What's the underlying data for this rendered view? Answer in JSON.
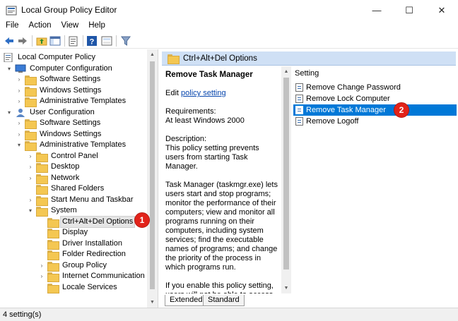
{
  "window": {
    "title": "Local Group Policy Editor",
    "minimize": "—",
    "maximize": "☐",
    "close": "✕"
  },
  "menu": [
    "File",
    "Action",
    "View",
    "Help"
  ],
  "tree": {
    "items": [
      {
        "label": "Local Computer Policy",
        "level": 0,
        "chevron": "",
        "icon": "policy-icon"
      },
      {
        "label": "Computer Configuration",
        "level": 1,
        "chevron": "▾",
        "icon": "computer-icon"
      },
      {
        "label": "Software Settings",
        "level": 2,
        "chevron": "›",
        "icon": "folder-icon"
      },
      {
        "label": "Windows Settings",
        "level": 2,
        "chevron": "›",
        "icon": "folder-icon"
      },
      {
        "label": "Administrative Templates",
        "level": 2,
        "chevron": "›",
        "icon": "folder-icon"
      },
      {
        "label": "User Configuration",
        "level": 1,
        "chevron": "▾",
        "icon": "user-icon"
      },
      {
        "label": "Software Settings",
        "level": 2,
        "chevron": "›",
        "icon": "folder-icon"
      },
      {
        "label": "Windows Settings",
        "level": 2,
        "chevron": "›",
        "icon": "folder-icon"
      },
      {
        "label": "Administrative Templates",
        "level": 2,
        "chevron": "▾",
        "icon": "folder-icon"
      },
      {
        "label": "Control Panel",
        "level": 3,
        "chevron": "›",
        "icon": "folder-icon"
      },
      {
        "label": "Desktop",
        "level": 3,
        "chevron": "›",
        "icon": "folder-icon"
      },
      {
        "label": "Network",
        "level": 3,
        "chevron": "›",
        "icon": "folder-icon"
      },
      {
        "label": "Shared Folders",
        "level": 3,
        "chevron": "",
        "icon": "folder-icon"
      },
      {
        "label": "Start Menu and Taskbar",
        "level": 3,
        "chevron": "›",
        "icon": "folder-icon"
      },
      {
        "label": "System",
        "level": 3,
        "chevron": "▾",
        "icon": "folder-icon"
      },
      {
        "label": "Ctrl+Alt+Del Options",
        "level": 4,
        "chevron": "",
        "icon": "folder-icon",
        "selected": true
      },
      {
        "label": "Display",
        "level": 4,
        "chevron": "",
        "icon": "folder-icon"
      },
      {
        "label": "Driver Installation",
        "level": 4,
        "chevron": "",
        "icon": "folder-icon"
      },
      {
        "label": "Folder Redirection",
        "level": 4,
        "chevron": "",
        "icon": "folder-icon"
      },
      {
        "label": "Group Policy",
        "level": 4,
        "chevron": "›",
        "icon": "folder-icon"
      },
      {
        "label": "Internet Communication M",
        "level": 4,
        "chevron": "›",
        "icon": "folder-icon"
      },
      {
        "label": "Locale Services",
        "level": 4,
        "chevron": "",
        "icon": "folder-icon"
      }
    ]
  },
  "right": {
    "header": "Ctrl+Alt+Del Options",
    "policy_title": "Remove Task Manager",
    "edit_prefix": "Edit ",
    "edit_link": "policy setting",
    "requirements": "Requirements:\nAt least Windows 2000",
    "description": "Description:\nThis policy setting prevents users from starting Task Manager.",
    "body1": "Task Manager (taskmgr.exe) lets users start and stop programs; monitor the performance of their computers; view and monitor all programs running on their computers, including system services; find the executable names of programs; and change the priority of the process in which programs run.",
    "body2": "If you enable this policy setting, users will not be able to access Task Manager. If users try to start",
    "settings_header": "Setting",
    "settings": [
      {
        "label": "Remove Change Password"
      },
      {
        "label": "Remove Lock Computer"
      },
      {
        "label": "Remove Task Manager",
        "selected": true
      },
      {
        "label": "Remove Logoff"
      }
    ]
  },
  "tabs": [
    "Extended",
    "Standard"
  ],
  "status": "4 setting(s)",
  "badges": [
    "1",
    "2"
  ],
  "colors": {
    "selection": "#0078d7",
    "header_band": "#cfe0f5",
    "badge": "#e2231a"
  }
}
